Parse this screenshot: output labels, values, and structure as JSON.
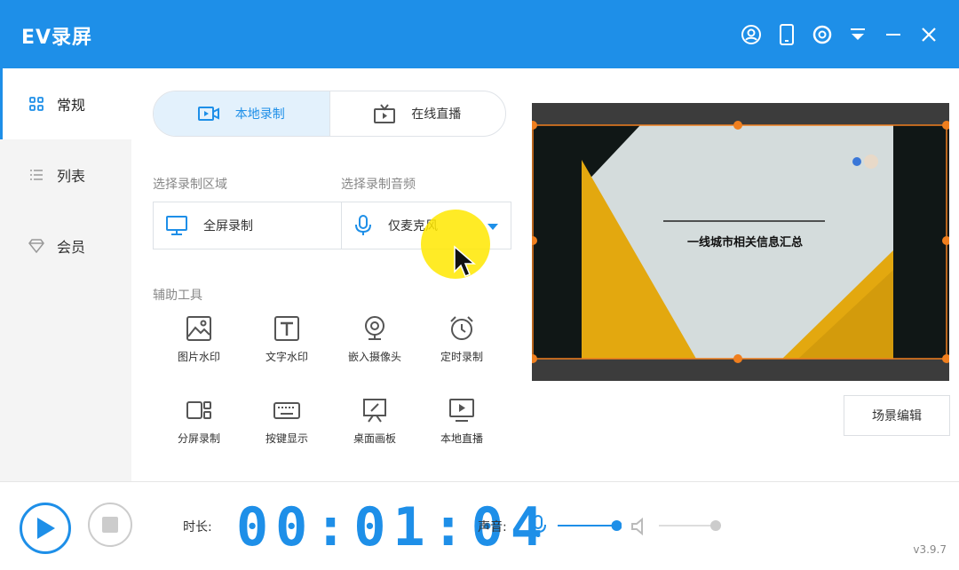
{
  "app": {
    "title": "EV录屏"
  },
  "titlebar": {
    "icons": [
      "user-icon",
      "phone-icon",
      "settings-icon",
      "menu-dropdown-icon",
      "minimize-icon",
      "close-icon"
    ]
  },
  "sidebar": {
    "items": [
      {
        "label": "常规",
        "icon": "grid-icon",
        "active": true
      },
      {
        "label": "列表",
        "icon": "list-icon",
        "active": false
      },
      {
        "label": "会员",
        "icon": "diamond-icon",
        "active": false
      }
    ]
  },
  "mode_tabs": [
    {
      "label": "本地录制",
      "active": true
    },
    {
      "label": "在线直播",
      "active": false
    }
  ],
  "region": {
    "label": "选择录制区域",
    "value": "全屏录制"
  },
  "audio": {
    "label": "选择录制音频",
    "value": "仅麦克风"
  },
  "tools": {
    "label": "辅助工具",
    "items": [
      {
        "label": "图片水印",
        "icon": "image-icon"
      },
      {
        "label": "文字水印",
        "icon": "text-icon"
      },
      {
        "label": "嵌入摄像头",
        "icon": "webcam-icon"
      },
      {
        "label": "定时录制",
        "icon": "alarm-clock-icon"
      },
      {
        "label": "分屏录制",
        "icon": "split-screen-icon"
      },
      {
        "label": "按键显示",
        "icon": "keyboard-icon"
      },
      {
        "label": "桌面画板",
        "icon": "easel-icon"
      },
      {
        "label": "本地直播",
        "icon": "monitor-play-icon"
      }
    ]
  },
  "preview": {
    "slide_title": "一线城市相关信息汇总"
  },
  "scene_edit": {
    "label": "场景编辑"
  },
  "bottom": {
    "duration_label": "时长:",
    "timer": "00:01:04",
    "sound_label": "声音:",
    "mic_volume": 0.95,
    "speaker_volume": 0.0,
    "version": "v3.9.7"
  },
  "colors": {
    "primary": "#1e8fe8",
    "accent_orange": "#f07f1e",
    "slide_yellow": "#e3a80f"
  }
}
